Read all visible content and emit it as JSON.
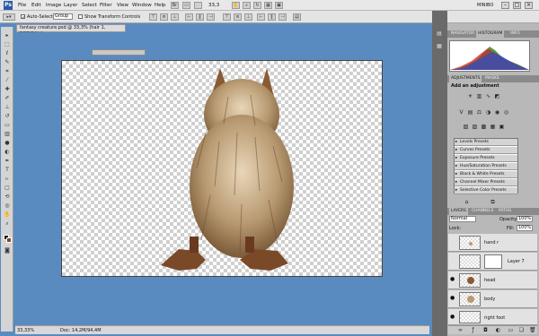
{
  "menubar": {
    "logo": "Ps",
    "items": [
      "File",
      "Edit",
      "Image",
      "Layer",
      "Select",
      "Filter",
      "View",
      "Window",
      "Help"
    ],
    "zoom": "33,3",
    "workspace": "MINIBO"
  },
  "options": {
    "auto_select_label": "Auto-Select:",
    "auto_select_value": "Group",
    "show_transform_label": "Show Transform Controls",
    "auto_select_checked": true,
    "show_transform_checked": false
  },
  "document": {
    "tab_title": "fantasy creature.psd @ 33,3% (hair 1, RGB/8#) *"
  },
  "status": {
    "zoom": "33,33%",
    "doc": "Doc: 14,2M/94,4M"
  },
  "panels": {
    "histogram_tabs": [
      "NAVIGATOR",
      "HISTOGRAM",
      "INFO"
    ],
    "histogram_active": "HISTOGRAM",
    "adj_tabs": [
      "ADJUSTMENTS",
      "MASKS"
    ],
    "adj_active": "ADJUSTMENTS",
    "adj_title": "Add an adjustment",
    "presets": [
      "Levels Presets",
      "Curves Presets",
      "Exposure Presets",
      "Hue/Saturation Presets",
      "Black & White Presets",
      "Channel Mixer Presets",
      "Selective Color Presets"
    ],
    "layers_tabs": [
      "LAYERS",
      "CHANNELS",
      "PATHS"
    ],
    "layers_active": "LAYERS",
    "blend_mode": "Normal",
    "opacity_label": "Opacity:",
    "opacity": "100%",
    "lock_label": "Lock:",
    "fill_label": "Fill:",
    "fill": "100%",
    "layers": [
      {
        "name": "hand r",
        "visible": false,
        "thumb": "hand"
      },
      {
        "name": "Layer 7",
        "visible": false,
        "thumb": "mask"
      },
      {
        "name": "head",
        "visible": true,
        "thumb": "head"
      },
      {
        "name": "body",
        "visible": true,
        "thumb": "body"
      },
      {
        "name": "right foot",
        "visible": true,
        "thumb": "foot"
      }
    ]
  },
  "colors": {
    "canvas_bg": "#5a8bc0",
    "fur": "#b89a72",
    "feet": "#7a4a28"
  }
}
